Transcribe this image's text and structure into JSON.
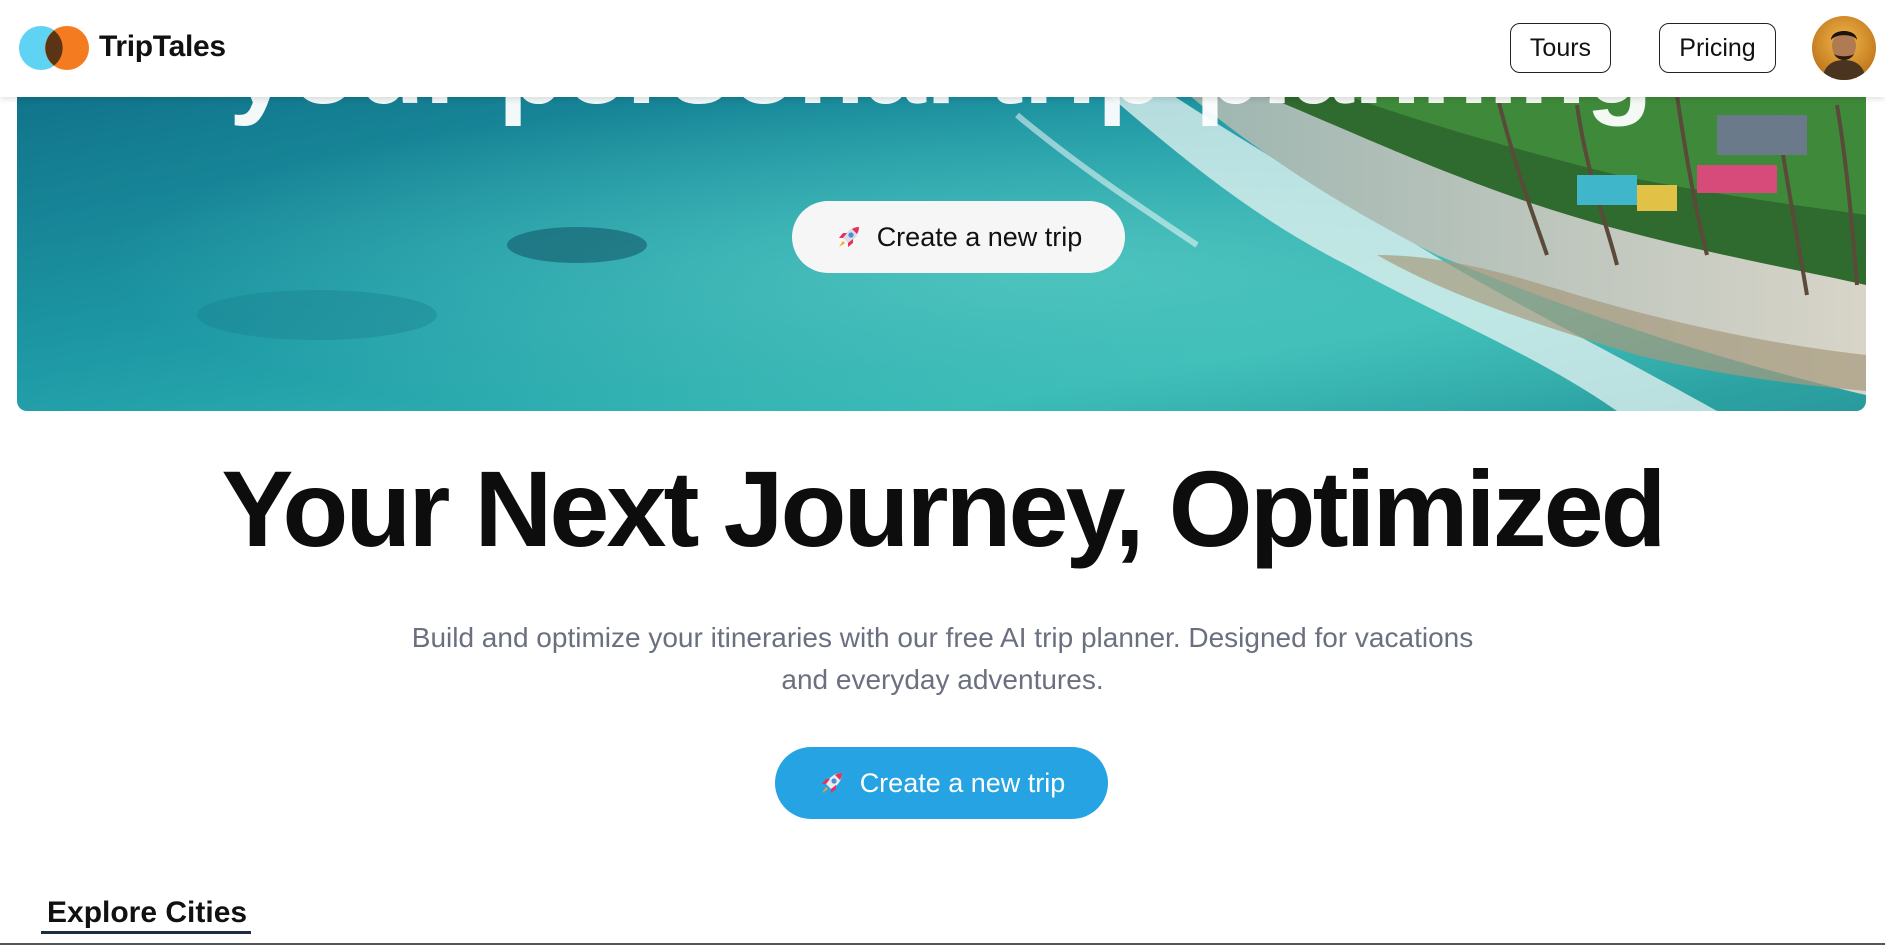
{
  "header": {
    "brand": "TripTales",
    "nav": [
      {
        "label": "Tours"
      },
      {
        "label": "Pricing"
      }
    ],
    "avatar_icon": "user-avatar"
  },
  "hero": {
    "cta_label": "Create a new trip",
    "cta_icon": "rocket-icon"
  },
  "main": {
    "headline": "Your Next Journey, Optimized",
    "subtitle_line1": "Build and optimize your itineraries with our free AI trip planner. Designed for vacations",
    "subtitle_line2": "and everyday adventures.",
    "cta_label": "Create a new trip",
    "cta_color": "#25a3e3"
  },
  "explore": {
    "title": "Explore Cities"
  },
  "colors": {
    "brand_cyan": "#5ed3f3",
    "brand_orange": "#f47b20",
    "cta_blue": "#25a3e3",
    "subtitle_gray": "#6b7080"
  }
}
